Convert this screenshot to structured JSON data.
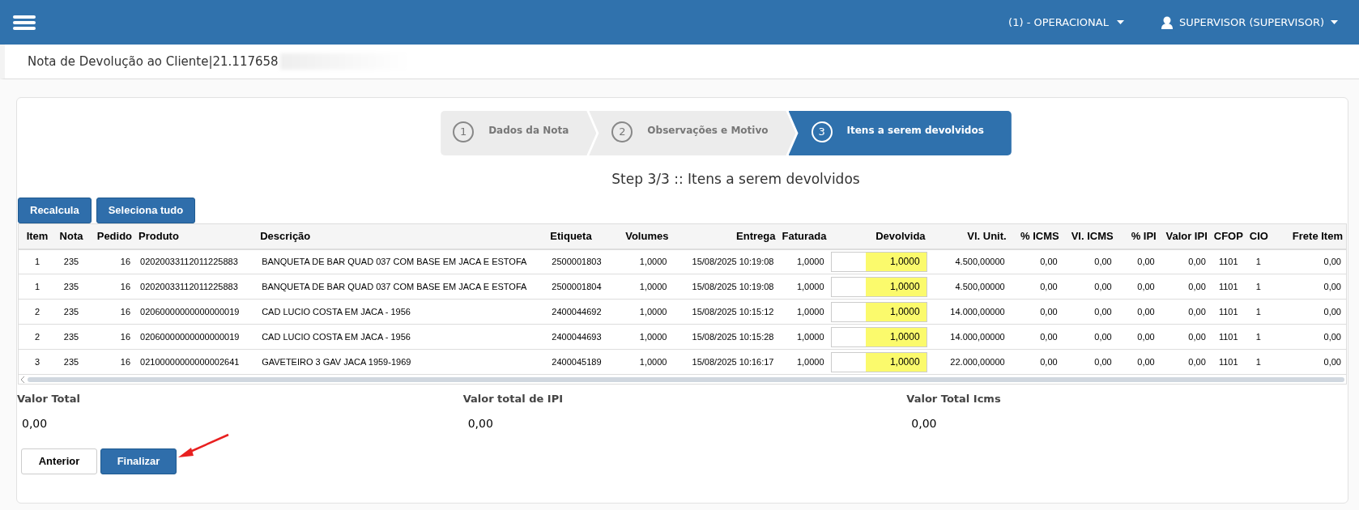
{
  "header": {
    "company": "(1) - OPERACIONAL",
    "user": "SUPERVISOR (SUPERVISOR)"
  },
  "page_title": "Nota de Devolução ao Cliente|21.117658",
  "steps": [
    {
      "number": "1",
      "label": "Dados da Nota",
      "selected": false
    },
    {
      "number": "2",
      "label": "Observações e Motivo",
      "selected": false
    },
    {
      "number": "3",
      "label": "Itens a serem devolvidos",
      "selected": true
    }
  ],
  "step_title": "Step 3/3 :: Itens a serem devolvidos",
  "toolbar": [
    "Recalcula",
    "Seleciona tudo"
  ],
  "table": {
    "columns": [
      "Item",
      "Nota",
      "Pedido",
      "Produto",
      "Descrição",
      "Etiqueta",
      "Volumes",
      "Entrega",
      "Faturada",
      "Devolvida",
      "Vl. Unit.",
      "% ICMS",
      "Vl. ICMS",
      "% IPI",
      "Valor IPI",
      "CFOP",
      "CIO",
      "Frete Item"
    ],
    "rows": [
      {
        "cells": [
          "1",
          "235",
          "16",
          "02020033112011225883",
          "BANQUETA DE BAR QUAD 037 COM BASE EM JACA E ESTOFA",
          "2500001803",
          "1,0000",
          "15/08/2025 10:19:08",
          "1,0000",
          "1,0000",
          "4.500,00000",
          "0,00",
          "0,00",
          "0,00",
          "0,00",
          "1101",
          "1",
          "0,00"
        ],
        "highlighted": true
      },
      {
        "cells": [
          "1",
          "235",
          "16",
          "02020033112011225883",
          "BANQUETA DE BAR QUAD 037 COM BASE EM JACA E ESTOFA",
          "2500001804",
          "1,0000",
          "15/08/2025 10:19:08",
          "1,0000",
          "1,0000",
          "4.500,00000",
          "0,00",
          "0,00",
          "0,00",
          "0,00",
          "1101",
          "1",
          "0,00"
        ],
        "highlighted": true
      },
      {
        "cells": [
          "2",
          "235",
          "16",
          "02060000000000000019",
          "CAD LUCIO COSTA EM JACA - 1956",
          "2400044692",
          "1,0000",
          "15/08/2025 10:15:12",
          "1,0000",
          "1,0000",
          "14.000,00000",
          "0,00",
          "0,00",
          "0,00",
          "0,00",
          "1101",
          "1",
          "0,00"
        ],
        "highlighted": true
      },
      {
        "cells": [
          "2",
          "235",
          "16",
          "02060000000000000019",
          "CAD LUCIO COSTA EM JACA - 1956",
          "2400044693",
          "1,0000",
          "15/08/2025 10:15:28",
          "1,0000",
          "1,0000",
          "14.000,00000",
          "0,00",
          "0,00",
          "0,00",
          "0,00",
          "1101",
          "1",
          "0,00"
        ],
        "highlighted": true
      },
      {
        "cells": [
          "3",
          "235",
          "16",
          "02100000000000002641",
          "GAVETEIRO 3 GAV JACA 1959-1969",
          "2400045189",
          "1,0000",
          "15/08/2025 10:16:17",
          "1,0000",
          "1,0000",
          "22.000,00000",
          "0,00",
          "0,00",
          "0,00",
          "0,00",
          "1101",
          "1",
          "0,00"
        ],
        "highlighted": true
      }
    ]
  },
  "totals": [
    {
      "label": "Valor Total",
      "value": "0,00"
    },
    {
      "label": "Valor total de IPI",
      "value": "0,00"
    },
    {
      "label": "Valor Total Icms",
      "value": "0,00"
    }
  ],
  "footer_buttons": [
    {
      "label": "Anterior",
      "kind": "secondary"
    },
    {
      "label": "Finalizar",
      "kind": "primary"
    }
  ]
}
